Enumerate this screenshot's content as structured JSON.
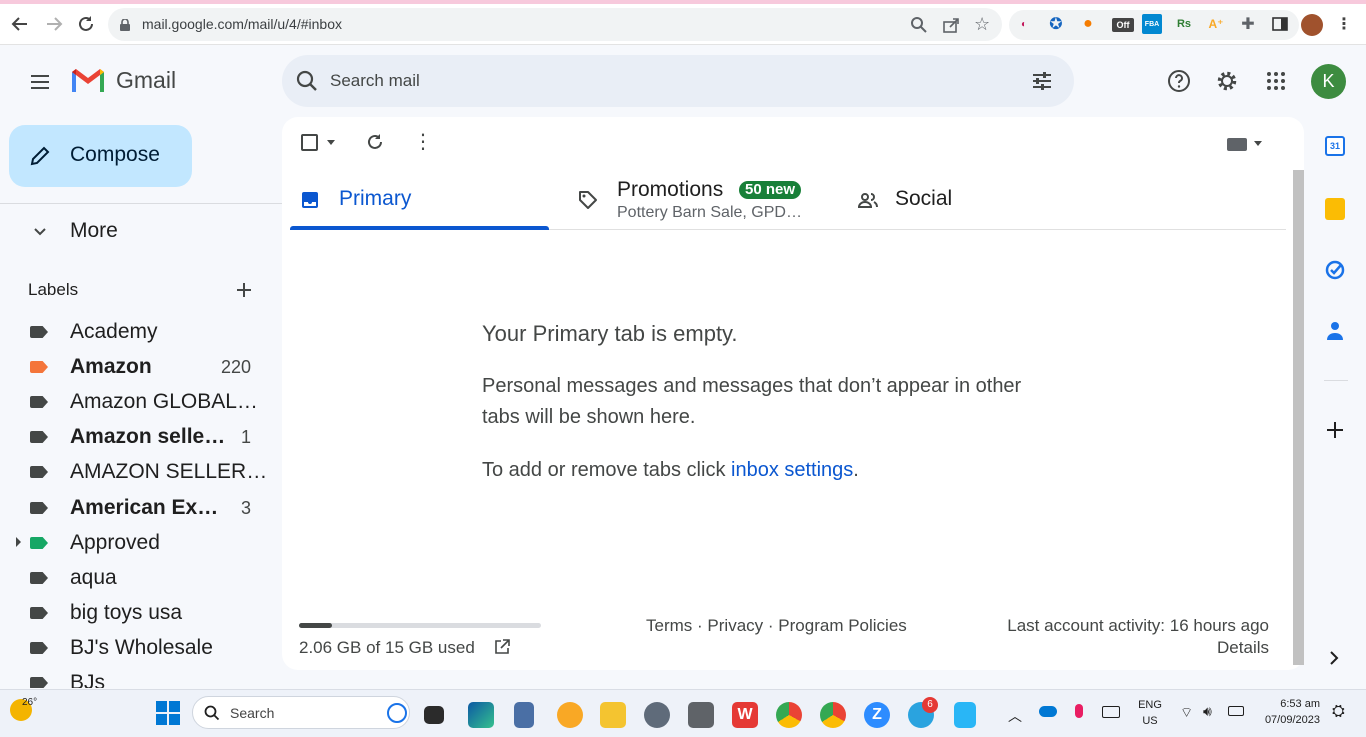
{
  "browser": {
    "url": "mail.google.com/mail/u/4/#inbox",
    "ext_off_label": "Off"
  },
  "gmail": {
    "product_name": "Gmail",
    "search_placeholder": "Search mail",
    "avatar_letter": "K",
    "compose_label": "Compose"
  },
  "sidebar": {
    "more_label": "More",
    "labels_heading": "Labels",
    "items": [
      {
        "label": "Academy",
        "count": "",
        "bold": false,
        "color": "#444746"
      },
      {
        "label": "Amazon",
        "count": "220",
        "bold": true,
        "color": "#f4753a"
      },
      {
        "label": "Amazon GLOBAL…",
        "count": "",
        "bold": false,
        "color": "#444746"
      },
      {
        "label": "Amazon selle…",
        "count": "1",
        "bold": true,
        "color": "#444746"
      },
      {
        "label": "AMAZON SELLER…",
        "count": "",
        "bold": false,
        "color": "#444746"
      },
      {
        "label": "American Ex…",
        "count": "3",
        "bold": true,
        "color": "#444746"
      },
      {
        "label": "Approved",
        "count": "",
        "bold": false,
        "color": "#16a765"
      },
      {
        "label": "aqua",
        "count": "",
        "bold": false,
        "color": "#444746"
      },
      {
        "label": "big toys usa",
        "count": "",
        "bold": false,
        "color": "#444746"
      },
      {
        "label": "BJ's Wholesale",
        "count": "",
        "bold": false,
        "color": "#444746"
      },
      {
        "label": "BJs",
        "count": "",
        "bold": false,
        "color": "#444746"
      }
    ]
  },
  "tabs": {
    "primary": "Primary",
    "promotions": "Promotions",
    "promotions_badge": "50 new",
    "promotions_snippet": "Pottery Barn Sale, GPD…",
    "social": "Social"
  },
  "empty_state": {
    "title": "Your Primary tab is empty.",
    "line1": "Personal messages and messages that don’t appear in other",
    "line2": "tabs will be shown here.",
    "settings_prefix": "To add or remove tabs click ",
    "settings_link": "inbox settings",
    "settings_suffix": "."
  },
  "footer": {
    "storage": "2.06 GB of 15 GB used",
    "storage_fraction": 0.137,
    "terms": "Terms",
    "privacy": "Privacy",
    "policies": "Program Policies",
    "sep": "·",
    "activity": "Last account activity: 16 hours ago",
    "details": "Details"
  },
  "taskbar": {
    "weather_temp": "26°",
    "search_label": "Search",
    "telegram_badge": "6",
    "lang_top": "ENG",
    "lang_bottom": "US",
    "time": "6:53 am",
    "date": "07/09/2023"
  },
  "right_rail": {
    "calendar_day": "31"
  }
}
